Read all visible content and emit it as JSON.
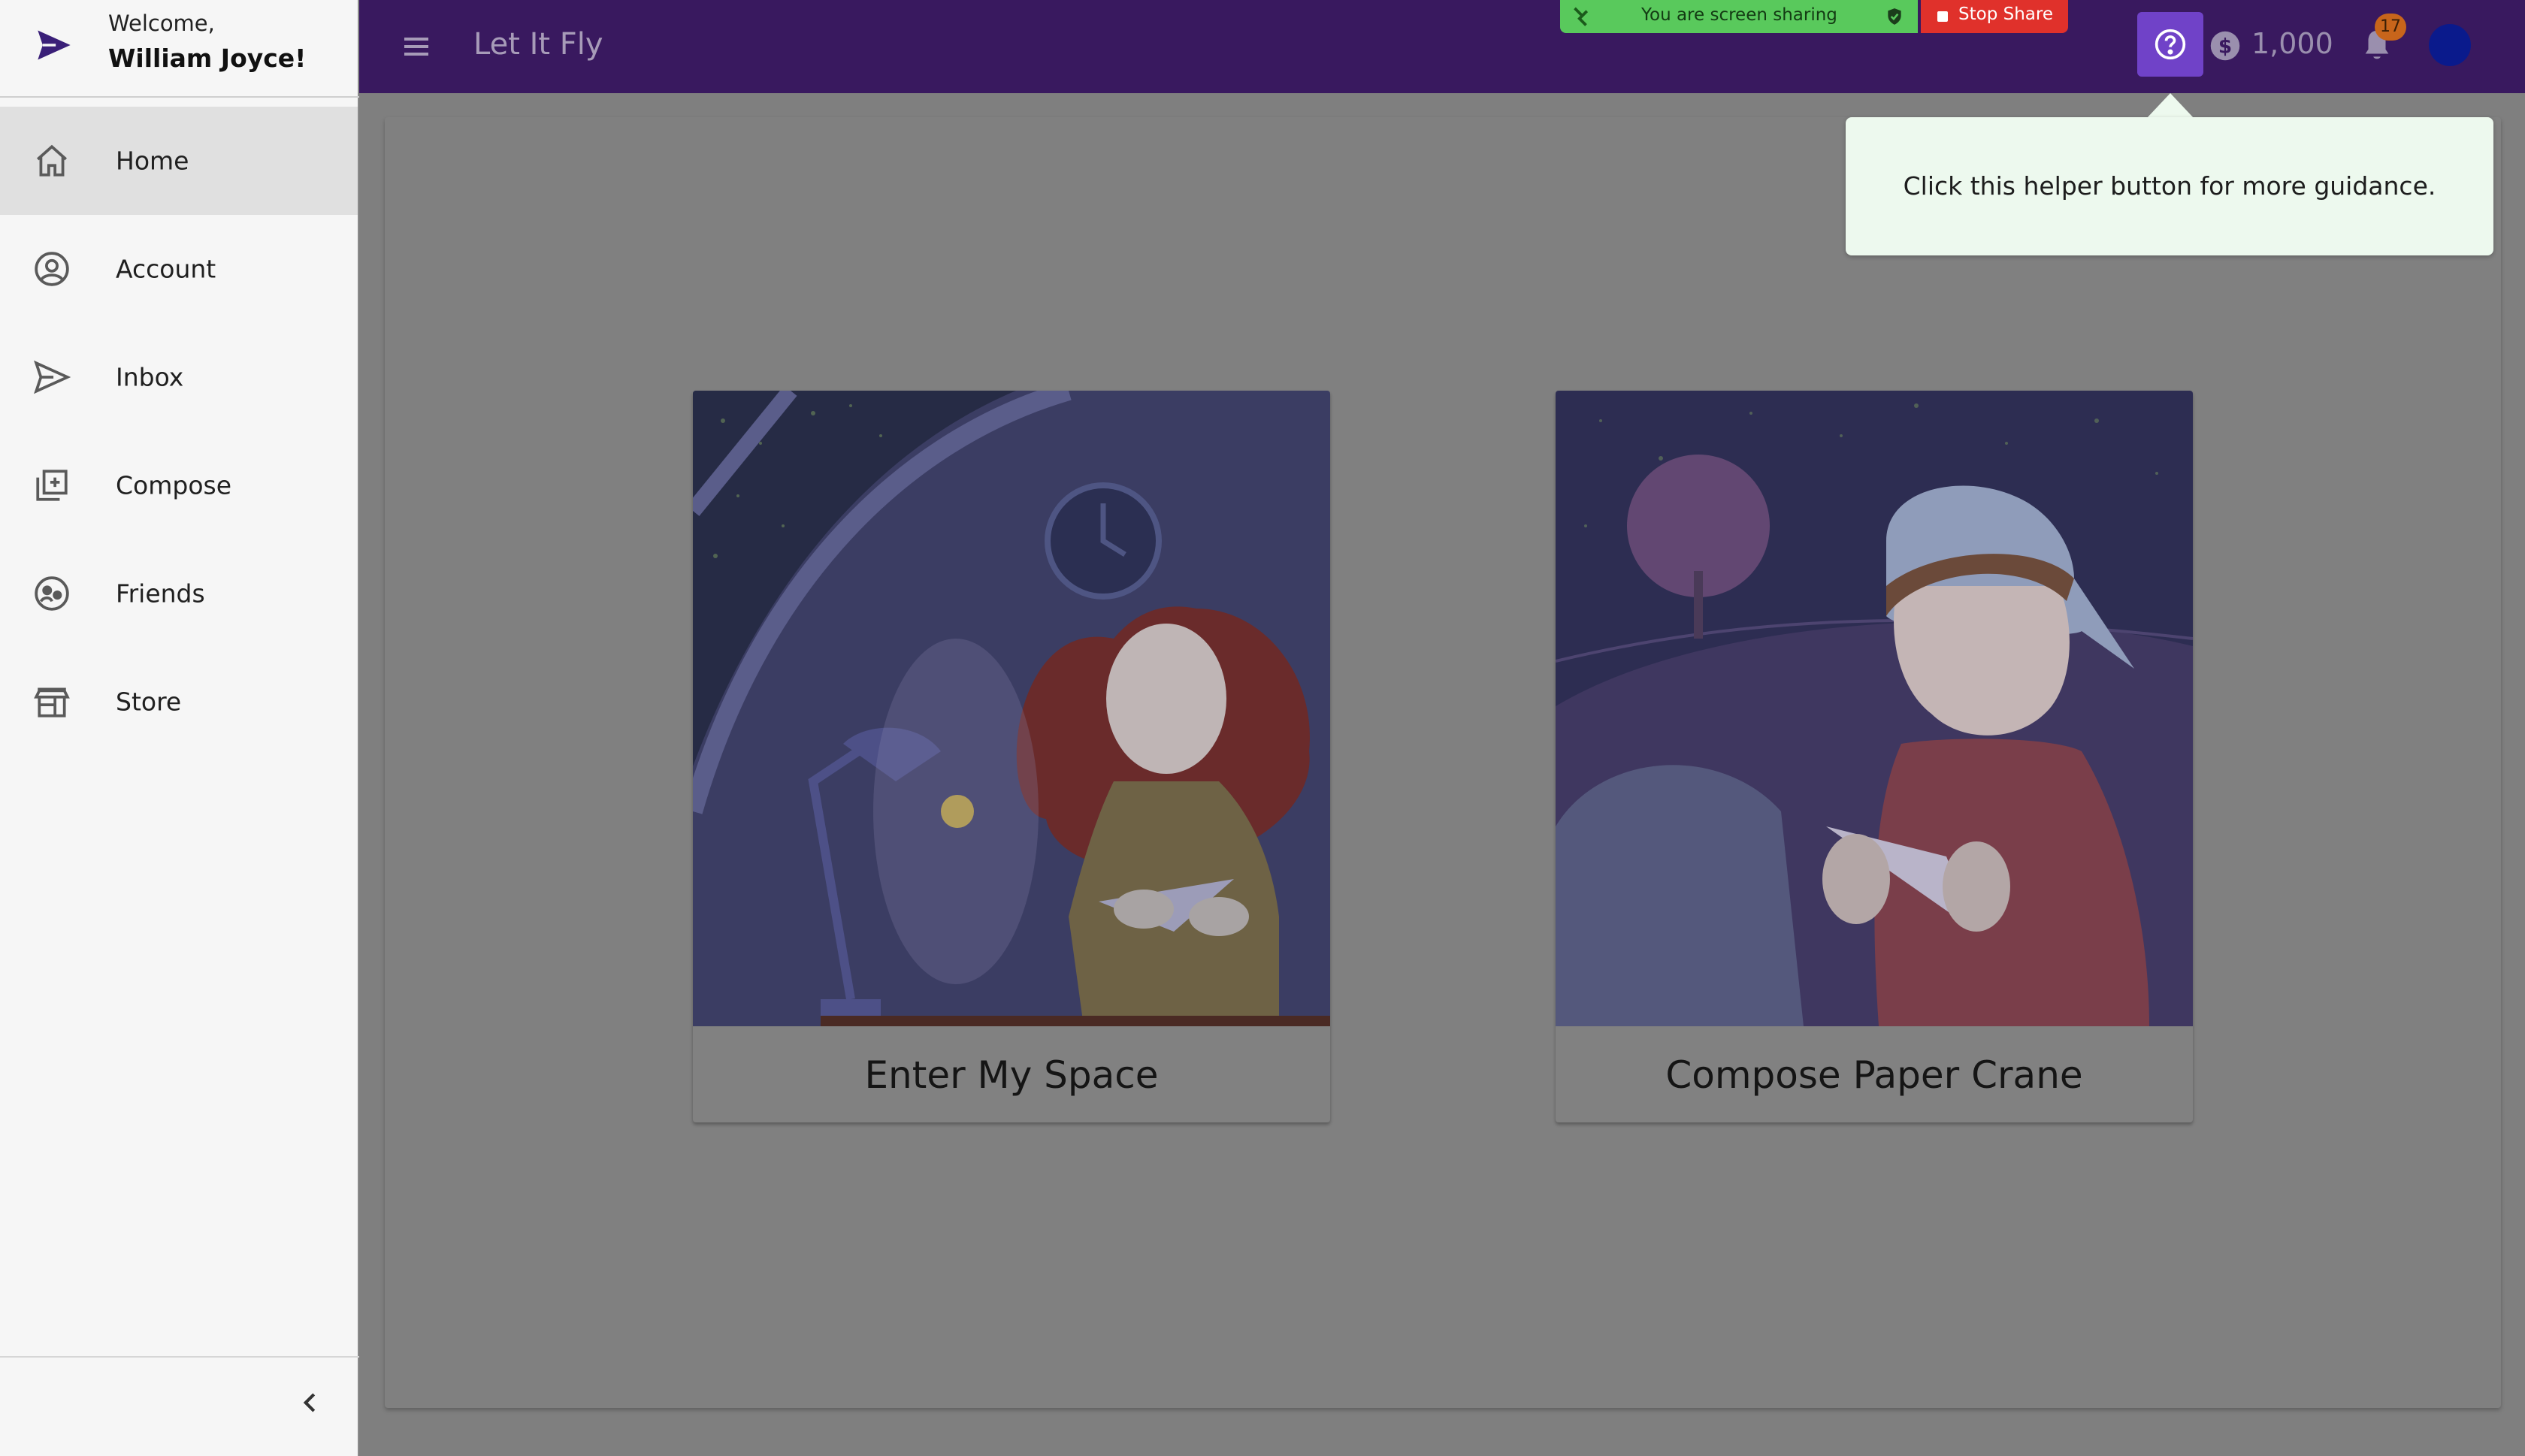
{
  "sidebar": {
    "welcome": "Welcome,",
    "user_name": "William Joyce!",
    "items": [
      {
        "label": "Home",
        "icon": "home-icon",
        "active": true
      },
      {
        "label": "Account",
        "icon": "account-icon",
        "active": false
      },
      {
        "label": "Inbox",
        "icon": "send-icon",
        "active": false
      },
      {
        "label": "Compose",
        "icon": "compose-icon",
        "active": false
      },
      {
        "label": "Friends",
        "icon": "friends-icon",
        "active": false
      },
      {
        "label": "Store",
        "icon": "store-icon",
        "active": false
      }
    ]
  },
  "header": {
    "app_title": "Let It Fly",
    "balance": "1,000",
    "notification_count": "17"
  },
  "screen_share": {
    "status_text": "You are screen sharing",
    "stop_label": "Stop Share"
  },
  "main": {
    "cards": [
      {
        "caption": "Enter My Space"
      },
      {
        "caption": "Compose Paper Crane"
      }
    ]
  },
  "tooltip": {
    "text": "Click this helper button for more guidance."
  },
  "colors": {
    "header_bg": "#39195f",
    "help_button": "#7042c8",
    "tooltip_bg": "#edf9ee",
    "share_green": "#59c95c",
    "stop_red": "#e0312b"
  }
}
